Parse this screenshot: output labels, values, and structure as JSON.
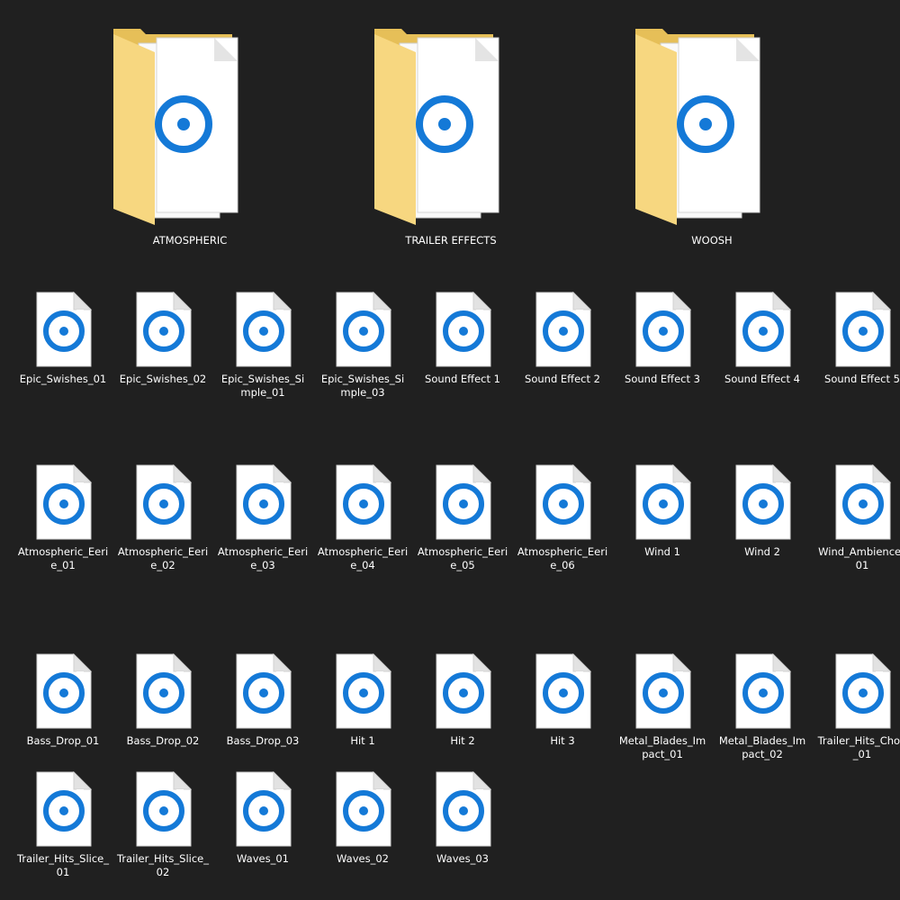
{
  "explorer": {
    "folders": [
      {
        "name": "ATMOSPHERIC",
        "icon": "folder-icon"
      },
      {
        "name": "TRAILER EFFECTS",
        "icon": "folder-icon"
      },
      {
        "name": "WOOSH",
        "icon": "folder-icon"
      }
    ],
    "files": [
      {
        "line1": "Epic_Swishes_01",
        "line2": "",
        "icon": "audio-file-icon"
      },
      {
        "line1": "Epic_Swishes_02",
        "line2": "",
        "icon": "audio-file-icon"
      },
      {
        "line1": "Epic_Swishes_Si",
        "line2": "mple_01",
        "icon": "audio-file-icon"
      },
      {
        "line1": "Epic_Swishes_Si",
        "line2": "mple_03",
        "icon": "audio-file-icon"
      },
      {
        "line1": "Sound Effect 1",
        "line2": "",
        "icon": "audio-file-icon"
      },
      {
        "line1": "Sound Effect 2",
        "line2": "",
        "icon": "audio-file-icon"
      },
      {
        "line1": "Sound Effect 3",
        "line2": "",
        "icon": "audio-file-icon"
      },
      {
        "line1": "Sound Effect 4",
        "line2": "",
        "icon": "audio-file-icon"
      },
      {
        "line1": "Sound Effect 5",
        "line2": "",
        "icon": "audio-file-icon"
      },
      {
        "line1": "Atmospheric_Eeri",
        "line2": "e_01",
        "icon": "audio-file-icon"
      },
      {
        "line1": "Atmospheric_Eeri",
        "line2": "e_02",
        "icon": "audio-file-icon"
      },
      {
        "line1": "Atmospheric_Eeri",
        "line2": "e_03",
        "icon": "audio-file-icon"
      },
      {
        "line1": "Atmospheric_Eeri",
        "line2": "e_04",
        "icon": "audio-file-icon"
      },
      {
        "line1": "Atmospheric_Eeri",
        "line2": "e_05",
        "icon": "audio-file-icon"
      },
      {
        "line1": "Atmospheric_Eeri",
        "line2": "e_06",
        "icon": "audio-file-icon"
      },
      {
        "line1": "Wind 1",
        "line2": "",
        "icon": "audio-file-icon"
      },
      {
        "line1": "Wind 2",
        "line2": "",
        "icon": "audio-file-icon"
      },
      {
        "line1": "Wind_Ambience_",
        "line2": "01",
        "icon": "audio-file-icon"
      },
      {
        "line1": "Bass_Drop_01",
        "line2": "",
        "icon": "audio-file-icon"
      },
      {
        "line1": "Bass_Drop_02",
        "line2": "",
        "icon": "audio-file-icon"
      },
      {
        "line1": "Bass_Drop_03",
        "line2": "",
        "icon": "audio-file-icon"
      },
      {
        "line1": "Hit 1",
        "line2": "",
        "icon": "audio-file-icon"
      },
      {
        "line1": "Hit 2",
        "line2": "",
        "icon": "audio-file-icon"
      },
      {
        "line1": "Hit 3",
        "line2": "",
        "icon": "audio-file-icon"
      },
      {
        "line1": "Metal_Blades_Im",
        "line2": "pact_01",
        "icon": "audio-file-icon"
      },
      {
        "line1": "Metal_Blades_Im",
        "line2": "pact_02",
        "icon": "audio-file-icon"
      },
      {
        "line1": "Trailer_Hits_Chop",
        "line2": "_01",
        "icon": "audio-file-icon"
      },
      {
        "line1": "Trailer_Hits_Slice_",
        "line2": "01",
        "icon": "audio-file-icon"
      },
      {
        "line1": "Trailer_Hits_Slice_",
        "line2": "02",
        "icon": "audio-file-icon"
      },
      {
        "line1": "Waves_01",
        "line2": "",
        "icon": "audio-file-icon"
      },
      {
        "line1": "Waves_02",
        "line2": "",
        "icon": "audio-file-icon"
      },
      {
        "line1": "Waves_03",
        "line2": "",
        "icon": "audio-file-icon"
      }
    ]
  },
  "colors": {
    "background": "#202020",
    "label_text": "#ffffff",
    "folder_back": "#e9c35a",
    "folder_front": "#f7d780",
    "audio_blue": "#1479d7",
    "page_white": "#ffffff"
  }
}
